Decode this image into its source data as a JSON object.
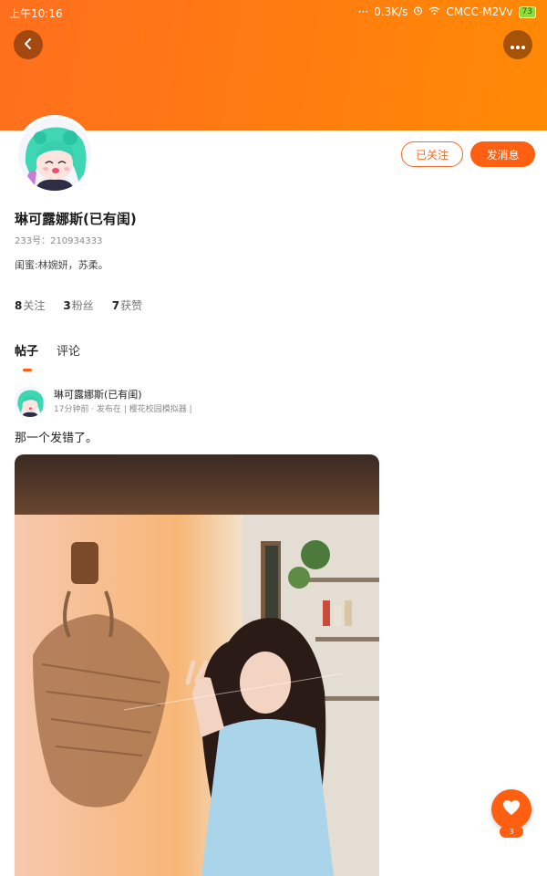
{
  "status_bar": {
    "time": "上午10:16",
    "dots": "···",
    "speed": "0.3K/s",
    "carrier": "CMCC-M2Vv",
    "battery": "73"
  },
  "profile": {
    "name": "琳可露娜斯(已有闺)",
    "uid": "233号：210934333",
    "bio": "闺蜜:林婉妍，苏柔。",
    "follow_button": "已关注",
    "message_button": "发消息",
    "stats": [
      {
        "count": "8",
        "label": "关注"
      },
      {
        "count": "3",
        "label": "粉丝"
      },
      {
        "count": "7",
        "label": "获赞"
      }
    ]
  },
  "tabs": [
    {
      "label": "帖子",
      "active": true
    },
    {
      "label": "评论",
      "active": false
    }
  ],
  "post": {
    "author": "琳可露娜斯(已有闺)",
    "meta": "17分钟前 · 发布在 | 樱花校园模拟器 |",
    "text": "那一个发错了。"
  },
  "like": {
    "count": "3"
  },
  "colors": {
    "accent": "#ff5f10",
    "banner": "#ff7a12"
  },
  "icons": [
    "back-icon",
    "more-icon",
    "heart-icon",
    "alarm-icon",
    "wifi-icon",
    "battery-icon"
  ]
}
